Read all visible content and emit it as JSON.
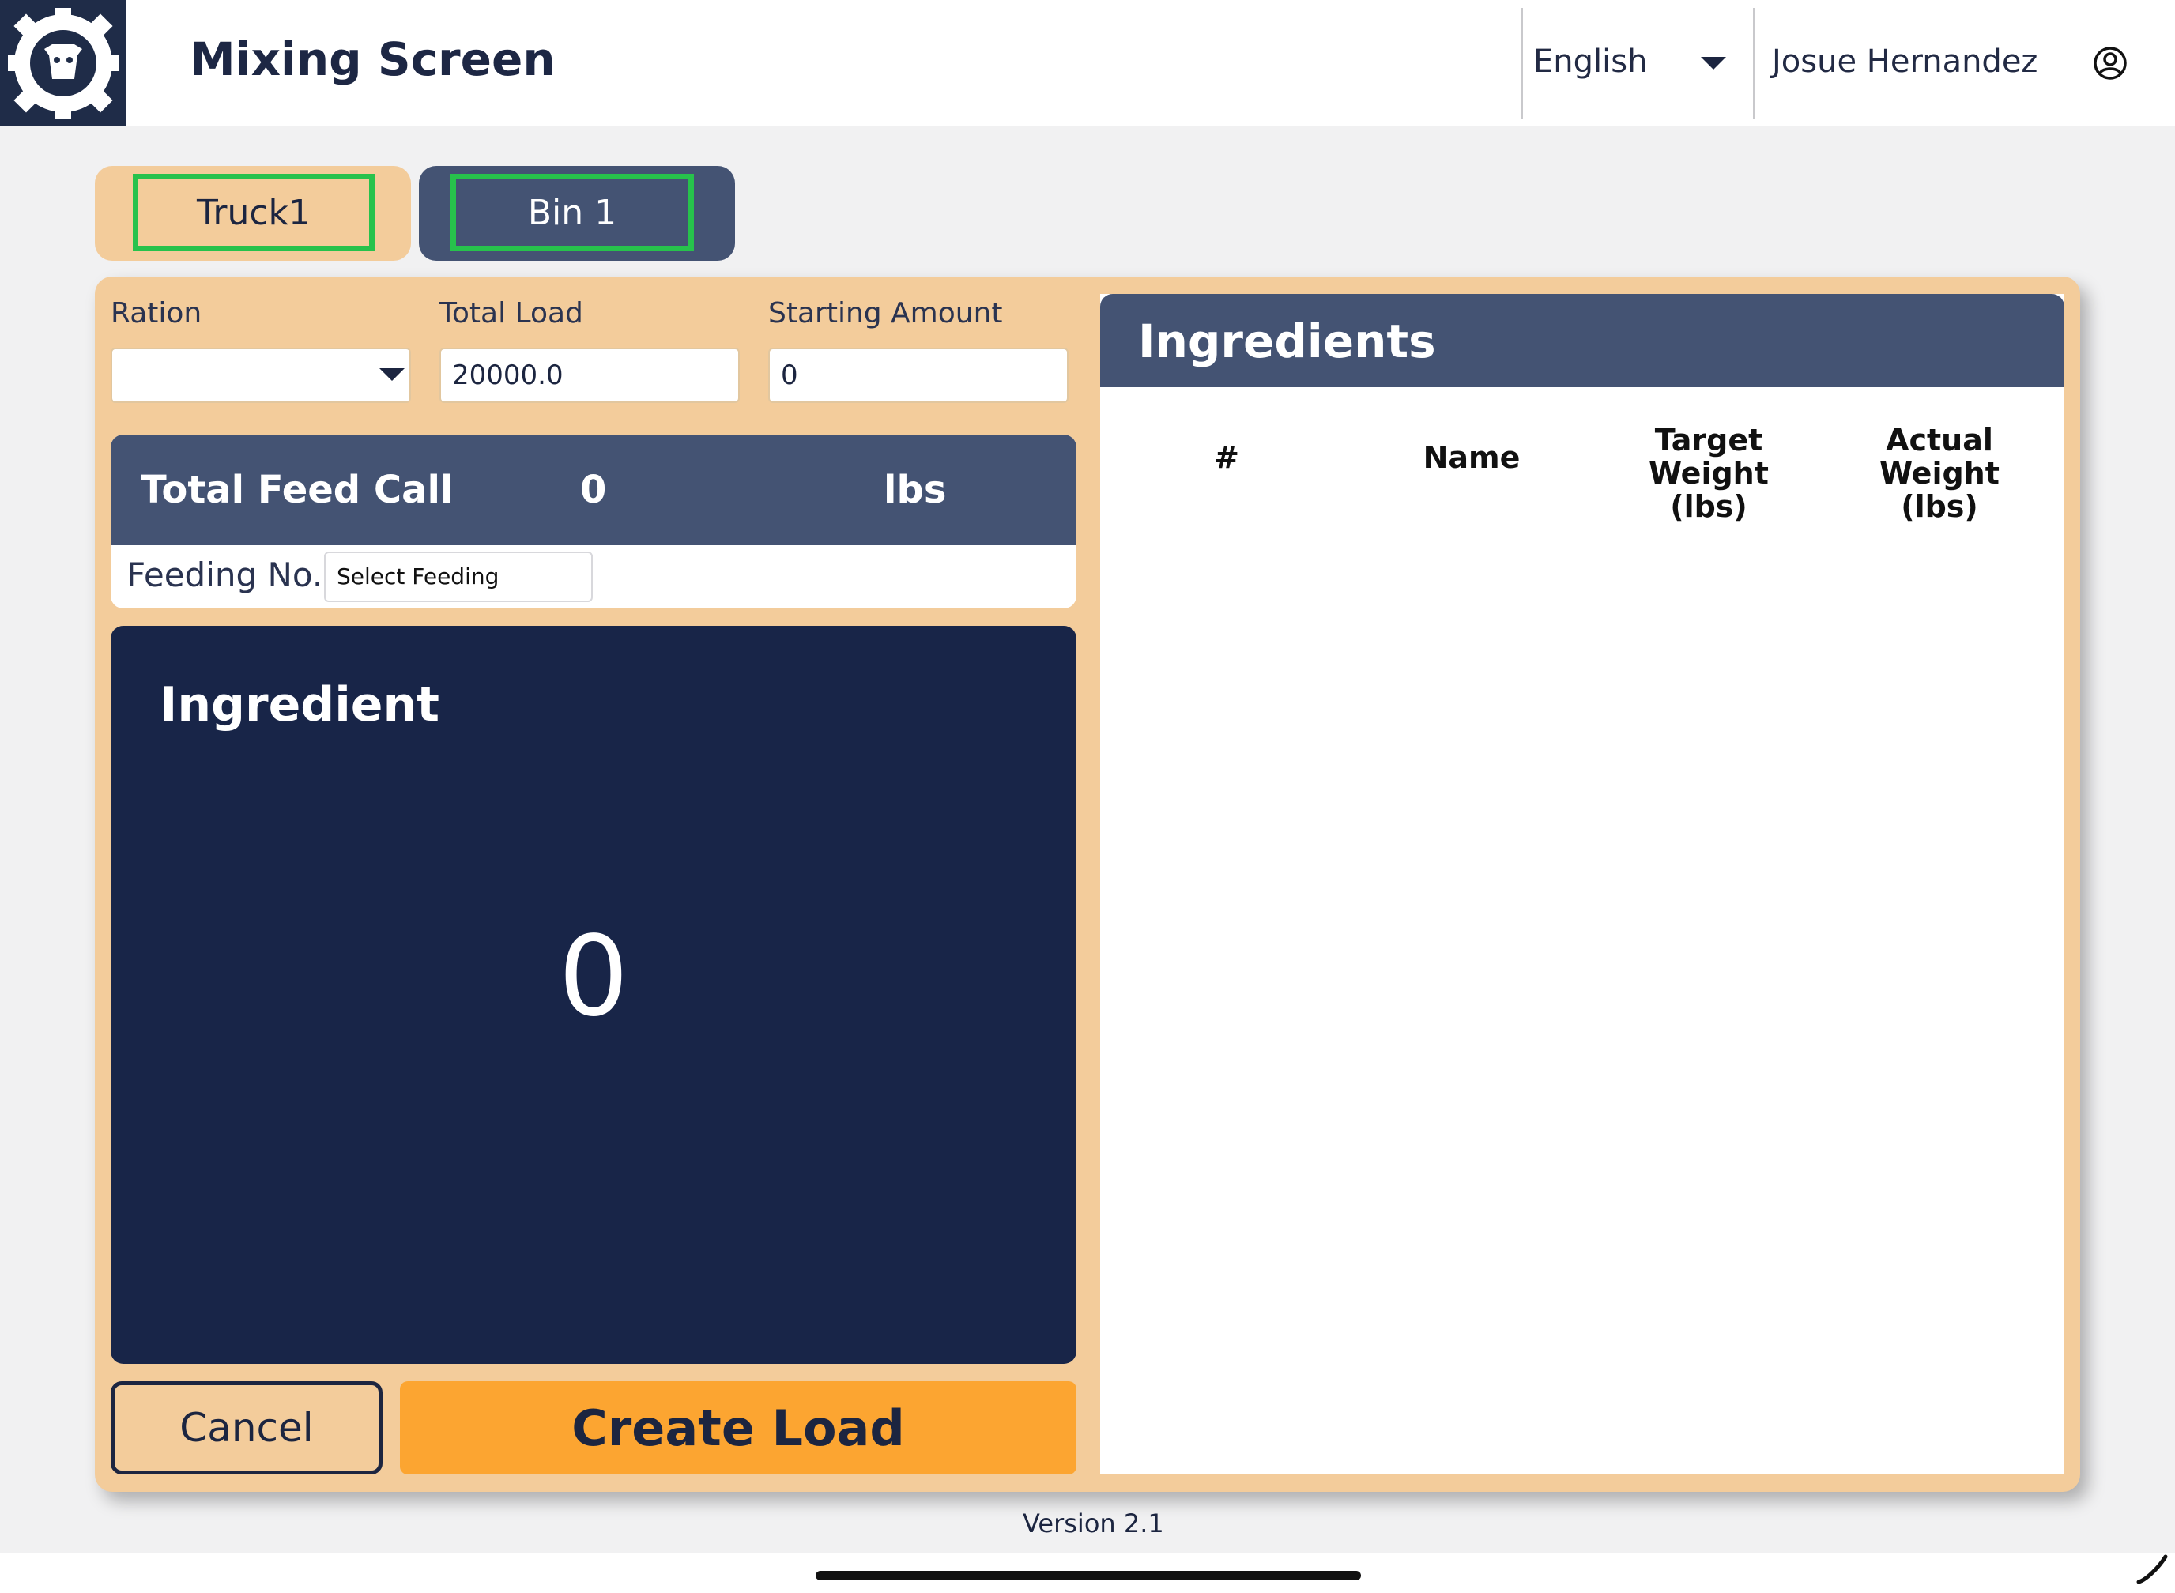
{
  "header": {
    "title": "Mixing Screen",
    "language": "English",
    "user_name": "Josue Hernandez"
  },
  "tabs": [
    {
      "label": "Truck1"
    },
    {
      "label": "Bin 1"
    }
  ],
  "form": {
    "ration_label": "Ration",
    "ration_value": "",
    "total_load_label": "Total Load",
    "total_load_value": "20000.0",
    "starting_amount_label": "Starting Amount",
    "starting_amount_value": "0"
  },
  "feed_call": {
    "label": "Total Feed Call",
    "value": "0",
    "unit": "lbs",
    "feeding_label": "Feeding No.",
    "feeding_placeholder": "Select Feeding"
  },
  "ingredient_display": {
    "title": "Ingredient",
    "value": "0"
  },
  "buttons": {
    "cancel": "Cancel",
    "create": "Create Load"
  },
  "ingredients_table": {
    "title": "Ingredients",
    "columns": [
      "#",
      "Name",
      "Target Weight\n(lbs)",
      "Actual Weight\n(lbs)"
    ],
    "rows": []
  },
  "footer": {
    "version": "Version 2.1"
  },
  "colors": {
    "accent_tan": "#f3cc9b",
    "navy": "#182548",
    "slate": "#445373",
    "orange": "#fca531",
    "highlight_green": "#27c24c"
  },
  "icons": [
    "gear-logo-icon",
    "chevron-down-icon",
    "user-account-icon"
  ]
}
